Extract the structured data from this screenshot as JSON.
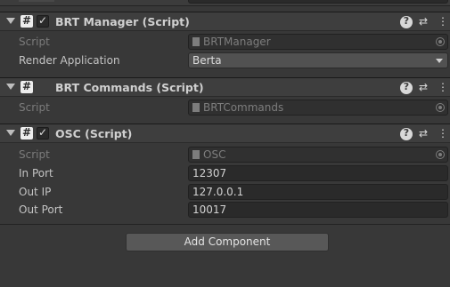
{
  "components": [
    {
      "title": "BRT Manager (Script)",
      "enabled": true,
      "script_label": "Script",
      "script_value": "BRTManager",
      "fields": [
        {
          "label": "Render Application",
          "value": "Berta"
        }
      ]
    },
    {
      "title": "BRT Commands (Script)",
      "script_label": "Script",
      "script_value": "BRTCommands"
    },
    {
      "title": "OSC (Script)",
      "enabled": true,
      "script_label": "Script",
      "script_value": "OSC",
      "fields": [
        {
          "label": "In Port",
          "value": "12307"
        },
        {
          "label": "Out IP",
          "value": "127.0.0.1"
        },
        {
          "label": "Out Port",
          "value": "10017"
        }
      ]
    }
  ],
  "icons": {
    "script": "#",
    "check": "✓",
    "help": "?",
    "presets": "⇄",
    "menu": "⋮"
  },
  "add_component_label": "Add Component"
}
